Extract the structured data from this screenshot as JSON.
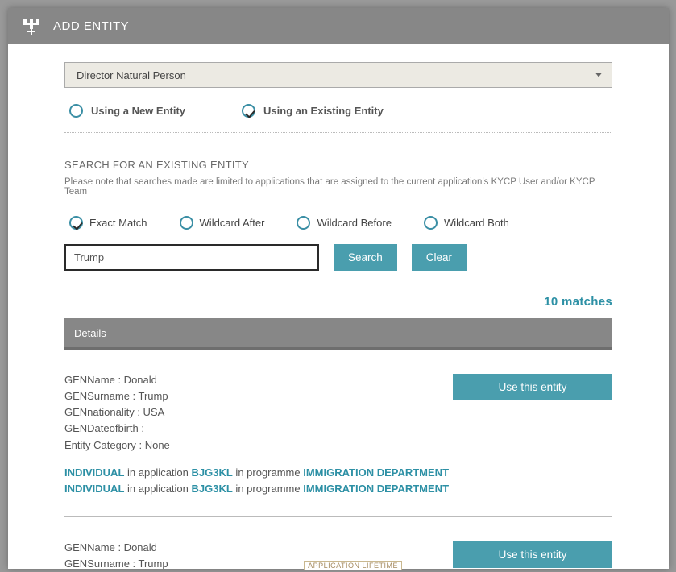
{
  "header": {
    "title": "ADD ENTITY"
  },
  "entity_type": {
    "selected": "Director Natural Person"
  },
  "entity_mode": {
    "new_label": "Using a New Entity",
    "existing_label": "Using an Existing Entity"
  },
  "search_section": {
    "title": "SEARCH FOR AN EXISTING ENTITY",
    "note": "Please note that searches made are limited to applications that are assigned to the current application's KYCP User and/or KYCP Team",
    "options": {
      "exact": "Exact Match",
      "wild_after": "Wildcard After",
      "wild_before": "Wildcard Before",
      "wild_both": "Wildcard Both"
    },
    "input_value": "Trump",
    "search_btn": "Search",
    "clear_btn": "Clear",
    "matches_text": "10 matches"
  },
  "details_header": "Details",
  "results": [
    {
      "fields": [
        "GENName : Donald",
        "GENSurname : Trump",
        "GENnationality : USA",
        "GENDateofbirth :",
        "Entity Category : None"
      ],
      "links": [
        {
          "type": "INDIVIDUAL",
          "mid": " in application ",
          "app": "BJG3KL",
          "mid2": " in programme ",
          "prog": "IMMIGRATION DEPARTMENT"
        },
        {
          "type": "INDIVIDUAL",
          "mid": " in application ",
          "app": "BJG3KL",
          "mid2": " in programme ",
          "prog": "IMMIGRATION DEPARTMENT"
        }
      ],
      "use_btn": "Use this entity"
    },
    {
      "fields": [
        "GENName : Donald",
        "GENSurname : Trump"
      ],
      "links": [],
      "use_btn": "Use this entity"
    }
  ],
  "footer_tag": "APPLICATION LIFETIME"
}
